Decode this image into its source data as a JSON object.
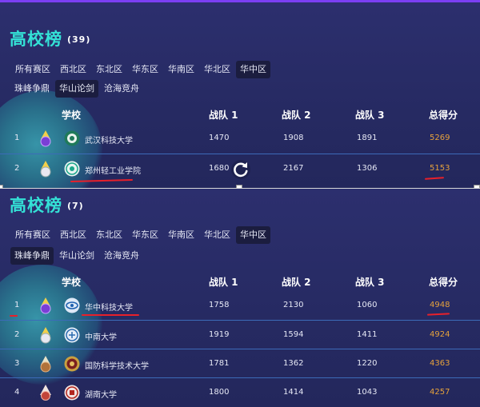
{
  "panel1": {
    "title": "高校榜",
    "count": "(39)",
    "regions": [
      "所有赛区",
      "西北区",
      "东北区",
      "华东区",
      "华南区",
      "华北区",
      "华中区"
    ],
    "active_region": "华中区",
    "groups": [
      "珠峰争鼎",
      "华山论剑",
      "沧海竞舟"
    ],
    "active_group": "华山论剑",
    "headers": [
      "学校",
      "战队 1",
      "战队 2",
      "战队 3",
      "总得分"
    ],
    "rows": [
      {
        "rank": "1",
        "school": "武汉科技大学",
        "t1": "1470",
        "t2": "1908",
        "t3": "1891",
        "total": "5269"
      },
      {
        "rank": "2",
        "school": "郑州轻工业学院",
        "t1": "1680",
        "t2": "2167",
        "t3": "1306",
        "total": "5153"
      }
    ]
  },
  "panel2": {
    "title": "高校榜",
    "count": "(7)",
    "regions": [
      "所有赛区",
      "西北区",
      "东北区",
      "华东区",
      "华南区",
      "华北区",
      "华中区"
    ],
    "active_region": "华中区",
    "groups": [
      "珠峰争鼎",
      "华山论剑",
      "沧海竞舟"
    ],
    "active_group": "珠峰争鼎",
    "headers": [
      "学校",
      "战队 1",
      "战队 2",
      "战队 3",
      "总得分"
    ],
    "rows": [
      {
        "rank": "1",
        "school": "华中科技大学",
        "t1": "1758",
        "t2": "2130",
        "t3": "1060",
        "total": "4948"
      },
      {
        "rank": "2",
        "school": "中南大学",
        "t1": "1919",
        "t2": "1594",
        "t3": "1411",
        "total": "4924"
      },
      {
        "rank": "3",
        "school": "国防科学技术大学",
        "t1": "1781",
        "t2": "1362",
        "t3": "1220",
        "total": "4363"
      },
      {
        "rank": "4",
        "school": "湖南大学",
        "t1": "1800",
        "t2": "1414",
        "t3": "1043",
        "total": "4257"
      }
    ]
  },
  "colors": {
    "title": "#34e1d6",
    "score": "#e6a23c",
    "annotation": "#e8202a",
    "row_separator": "#3c6bb8"
  }
}
